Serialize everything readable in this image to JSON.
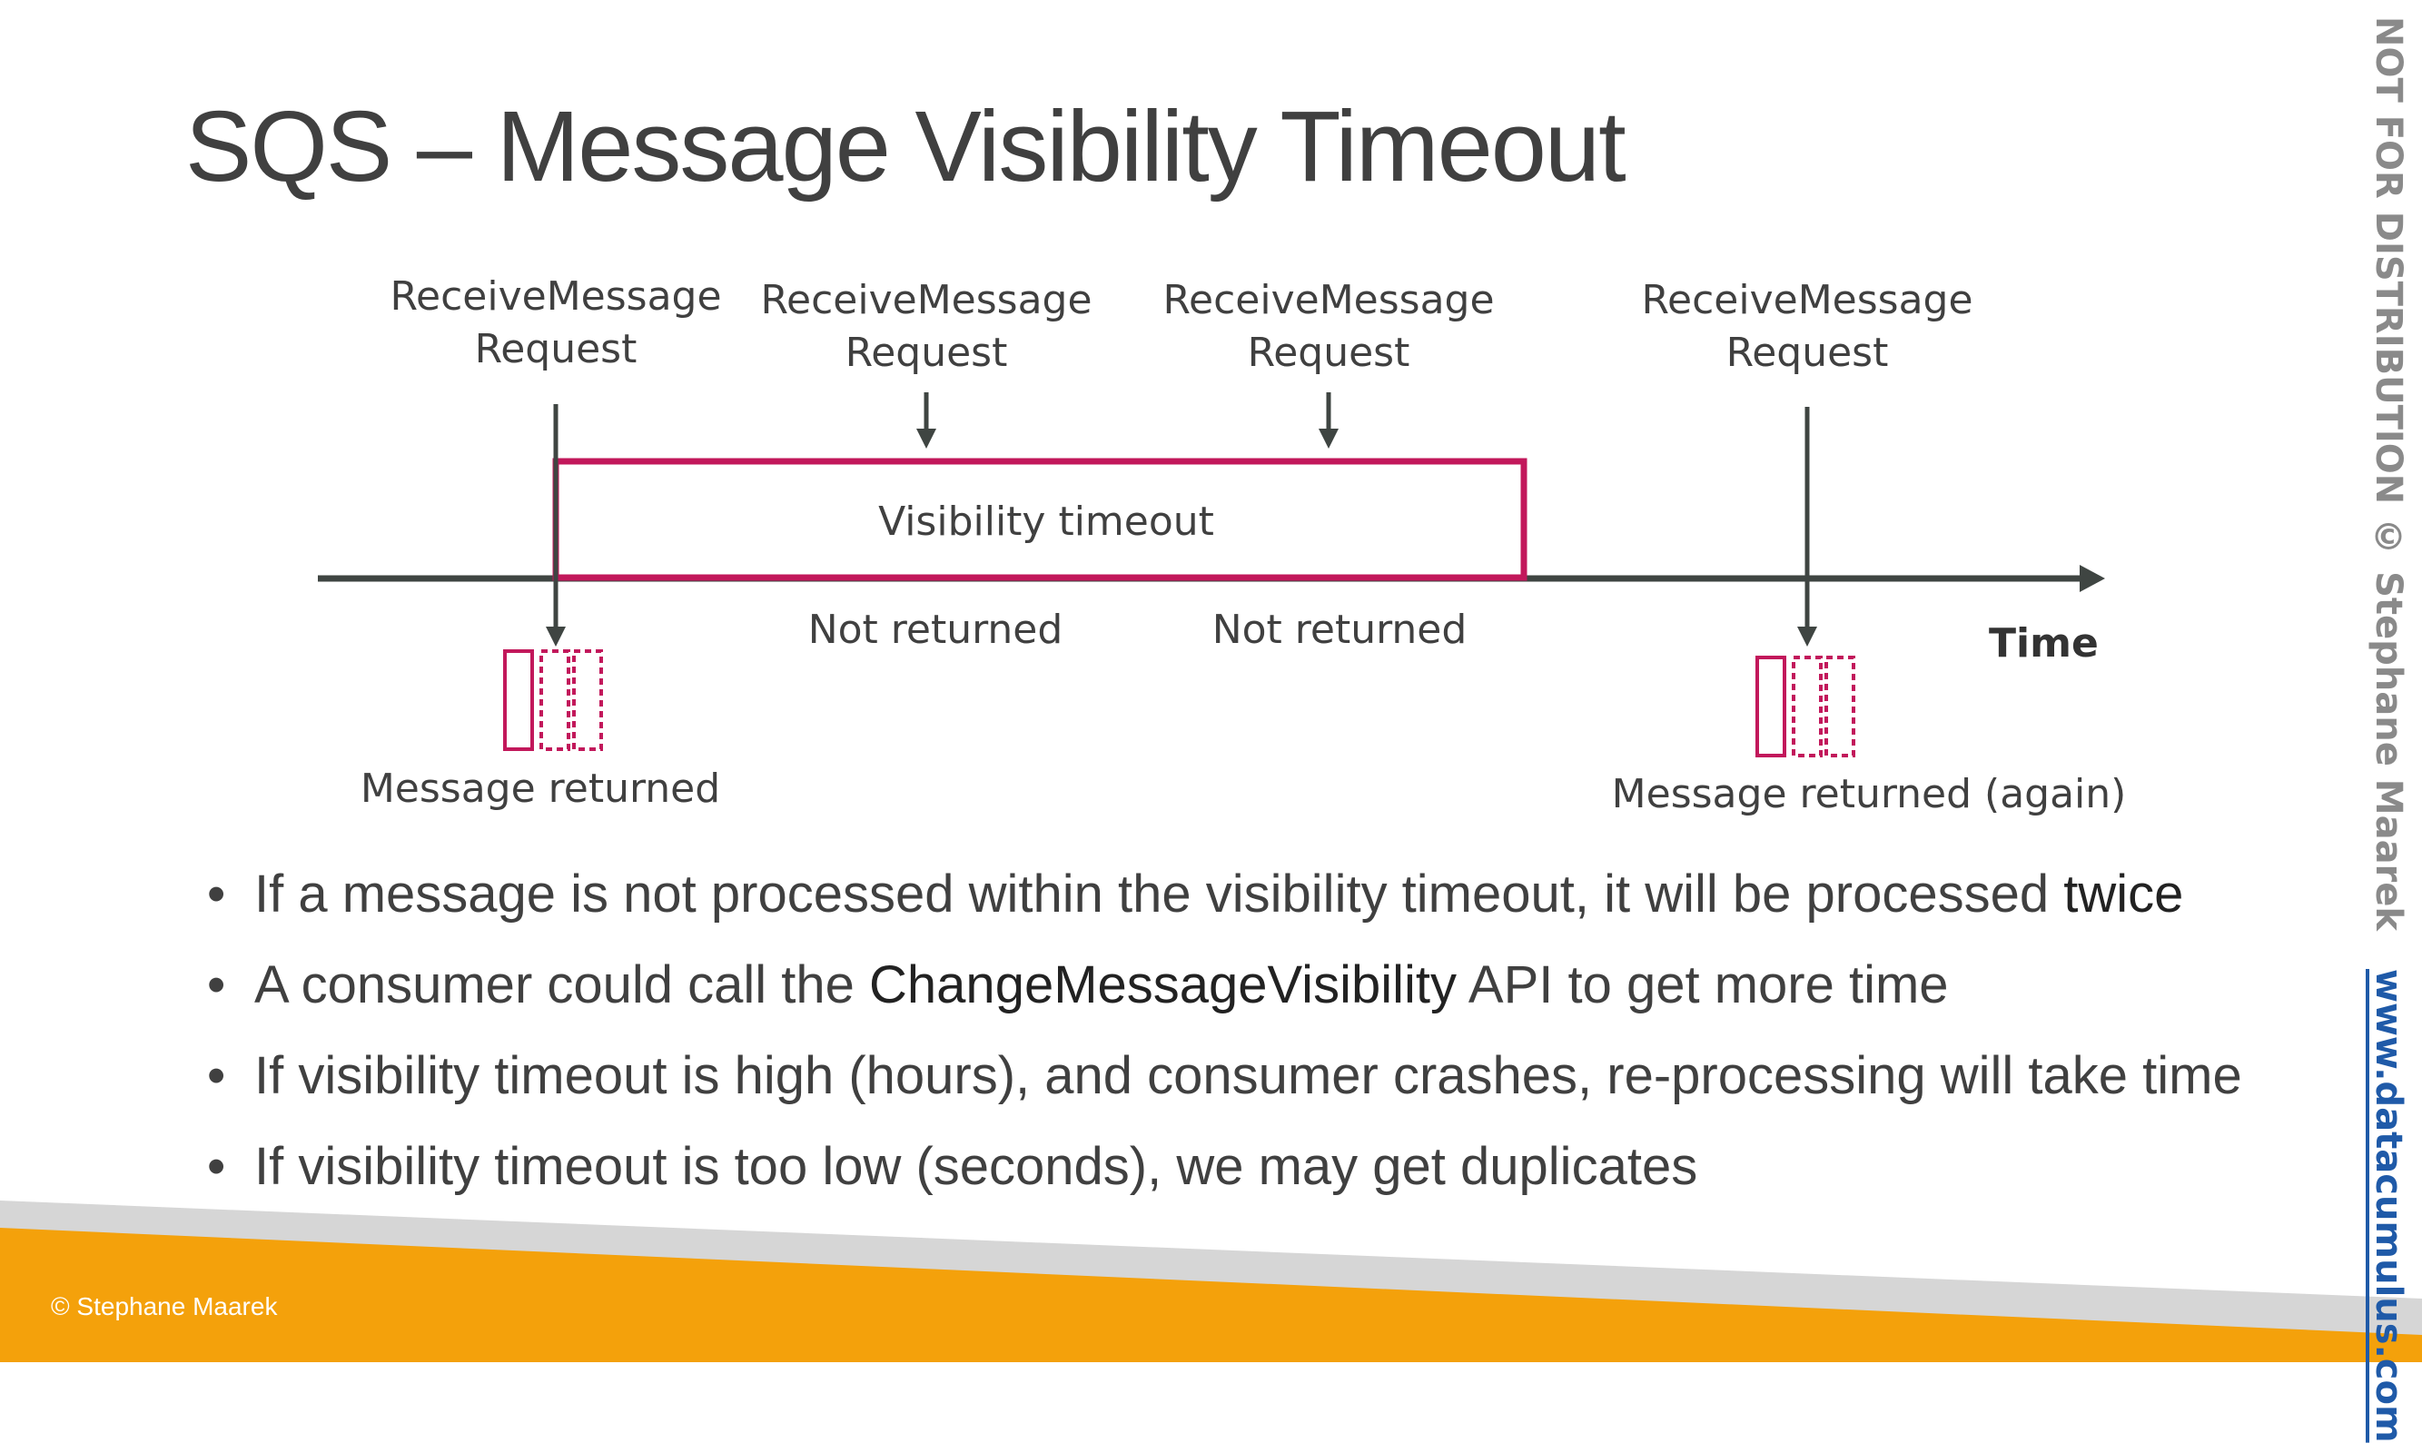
{
  "title": "SQS – Message Visibility Timeout",
  "diagram": {
    "requests": [
      {
        "line1": "ReceiveMessage",
        "line2": "Request"
      },
      {
        "line1": "ReceiveMessage",
        "line2": "Request"
      },
      {
        "line1": "ReceiveMessage",
        "line2": "Request"
      },
      {
        "line1": "ReceiveMessage",
        "line2": "Request"
      }
    ],
    "visibility_timeout_label": "Visibility timeout",
    "not_returned": [
      "Not returned",
      "Not returned"
    ],
    "time_label": "Time",
    "message_returned": "Message returned",
    "message_returned_again": "Message returned (again)",
    "colors": {
      "accent": "#c2185b",
      "line": "#3f4542"
    }
  },
  "bullets": {
    "b1_text": "If a message is not processed within the visibility timeout, it will be processed ",
    "b1_emph": "twice",
    "b2_pre": "A consumer could call the ",
    "b2_emph": "ChangeMessageVisibility",
    "b2_post": " API to get more time",
    "b3": "If visibility timeout is high (hours), and consumer crashes, re-processing will take time",
    "b4": "If visibility timeout is too low (seconds), we may get duplicates"
  },
  "footer": {
    "copyright": "© Stephane Maarek",
    "colors": {
      "orange": "#f4a10b",
      "gray": "#d6d6d6"
    }
  },
  "watermark": {
    "text": "NOT FOR DISTRIBUTION © Stephane Maarek",
    "link": "www.datacumulus.com"
  }
}
